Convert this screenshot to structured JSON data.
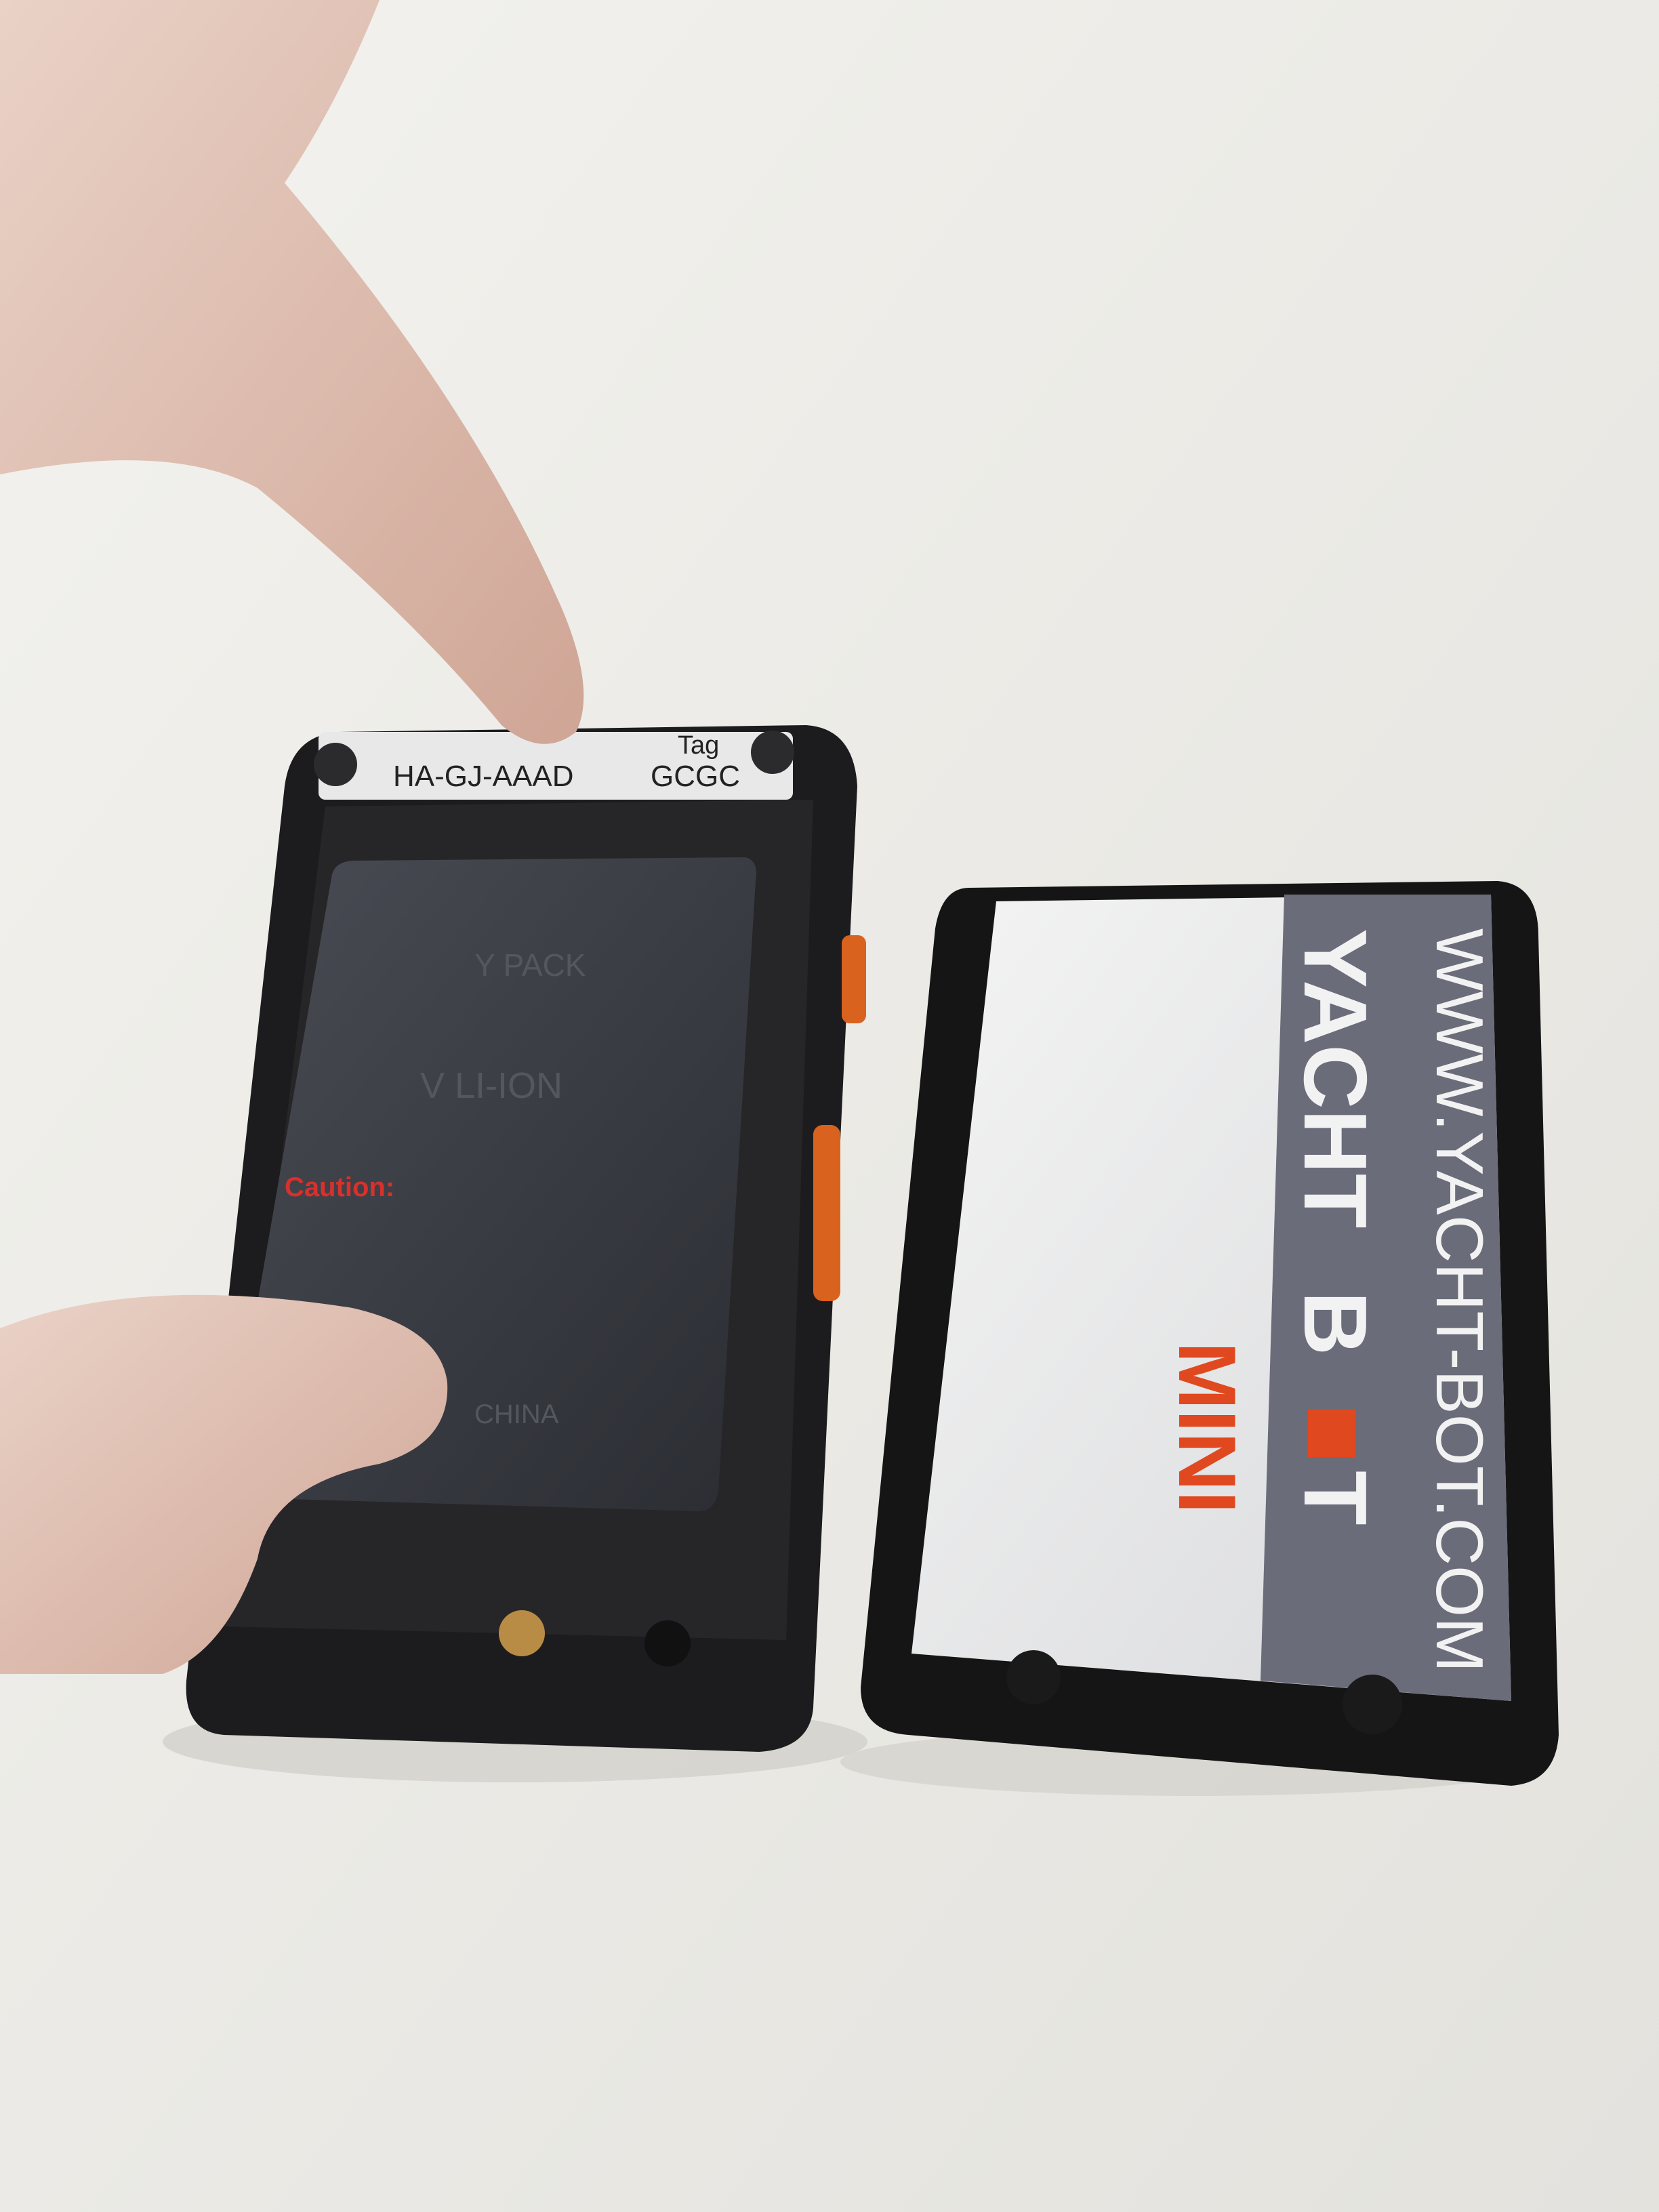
{
  "device": {
    "label_serial_fragment": "HA-GJ-AAAD",
    "label_tag_heading": "Tag",
    "label_tag_value": "GCGC",
    "battery": {
      "pack_text": "Y PACK",
      "chem_text": "V LI-ION",
      "caution_title": "Caution:",
      "origin_text": "CHINA"
    }
  },
  "cover": {
    "website": "WWW.YACHT-BOT.COM",
    "brand_yacht": "YACHT",
    "brand_b": "B",
    "brand_t": "T",
    "model": "MINI"
  },
  "colors": {
    "accent_orange": "#e0481f",
    "cover_stripe": "#6b6c7a",
    "device_body": "#1c1c1e"
  }
}
